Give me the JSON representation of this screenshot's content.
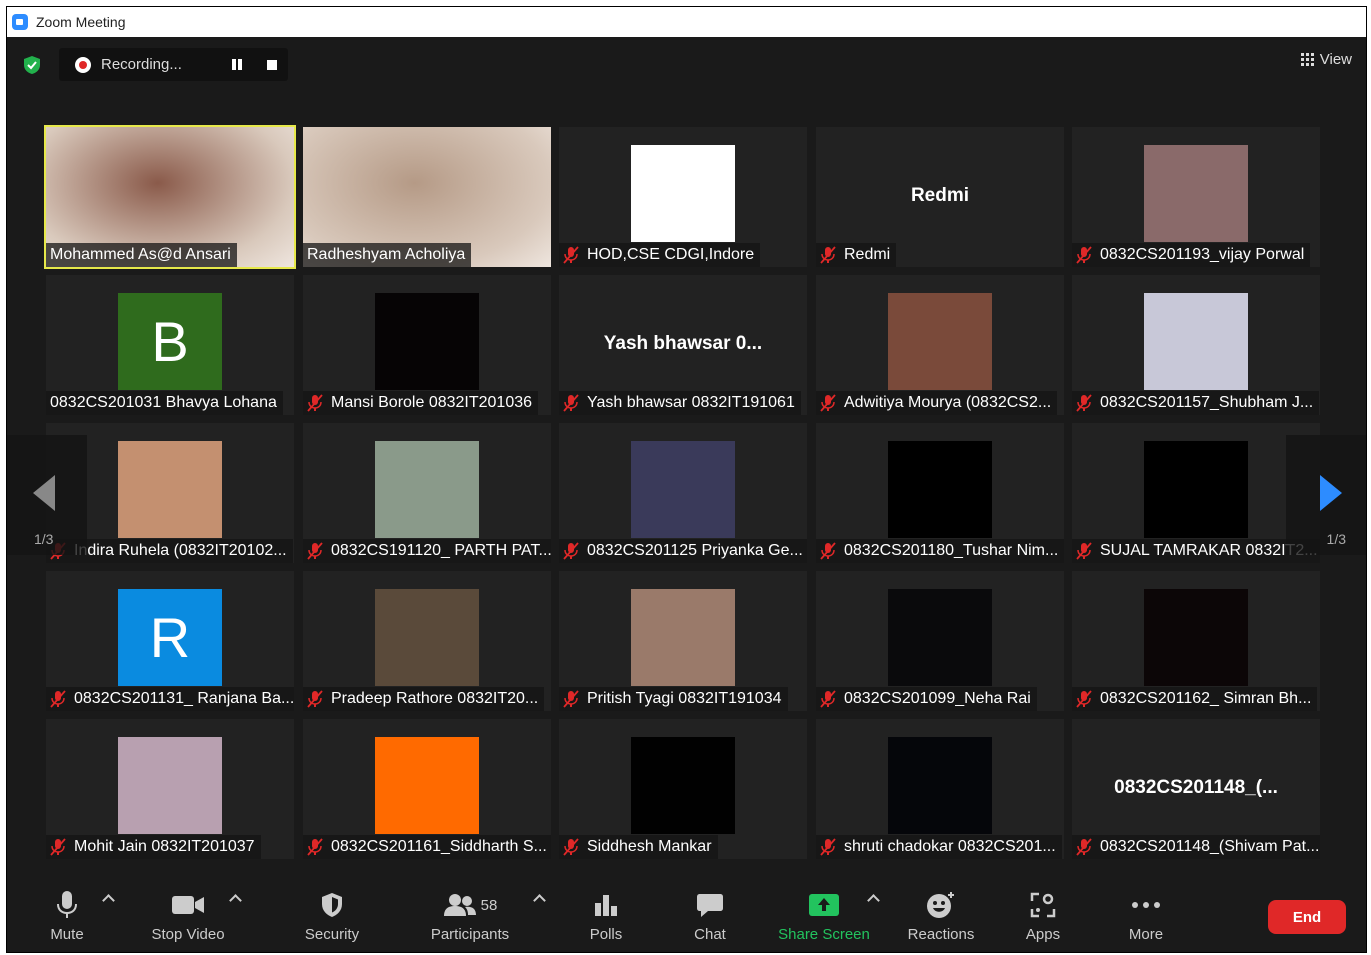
{
  "window": {
    "title": "Zoom Meeting"
  },
  "recording": {
    "label": "Recording..."
  },
  "view": {
    "label": "View"
  },
  "tiles": [
    {
      "name": "Mohammed As@d Ansari",
      "muted": false,
      "type": "video",
      "bg": "#8a5a4a",
      "active": true
    },
    {
      "name": "Radheshyam Acholiya",
      "muted": false,
      "type": "video",
      "bg": "#b59a86"
    },
    {
      "name": "HOD,CSE CDGI,Indore",
      "muted": true,
      "type": "thumb",
      "bg": "#ffffff"
    },
    {
      "name": "Redmi",
      "muted": true,
      "type": "text",
      "display": "Redmi"
    },
    {
      "name": "0832CS201193_vijay Porwal",
      "muted": true,
      "type": "thumb",
      "bg": "#8a6a6a"
    },
    {
      "name": "0832CS201031 Bhavya Lohana",
      "muted": false,
      "type": "avatar",
      "bg": "#2f6b1d",
      "letter": "B"
    },
    {
      "name": "Mansi Borole 0832IT201036",
      "muted": true,
      "type": "thumb",
      "bg": "#060405"
    },
    {
      "name": "Yash bhawsar 0832IT191061",
      "muted": true,
      "type": "text",
      "display": "Yash bhawsar 0..."
    },
    {
      "name": "Adwitiya Mourya (0832CS2...",
      "muted": true,
      "type": "thumb",
      "bg": "#7a4a3a"
    },
    {
      "name": "0832CS201157_Shubham J...",
      "muted": true,
      "type": "thumb",
      "bg": "#c8c8d8"
    },
    {
      "name": "Indira Ruhela (0832IT20102...",
      "muted": true,
      "type": "thumb",
      "bg": "#c49070"
    },
    {
      "name": "0832CS191120_ PARTH PAT...",
      "muted": true,
      "type": "thumb",
      "bg": "#8a9a8a"
    },
    {
      "name": "0832CS201125 Priyanka Ge...",
      "muted": true,
      "type": "thumb",
      "bg": "#3a3a5a"
    },
    {
      "name": "0832CS201180_Tushar Nim...",
      "muted": true,
      "type": "thumb",
      "bg": "#000000"
    },
    {
      "name": "SUJAL TAMRAKAR 0832IT2...",
      "muted": true,
      "type": "thumb",
      "bg": "#000000"
    },
    {
      "name": "0832CS201131_ Ranjana Ba...",
      "muted": true,
      "type": "avatar",
      "bg": "#0a8be0",
      "letter": "R"
    },
    {
      "name": "Pradeep Rathore 0832IT20...",
      "muted": true,
      "type": "thumb",
      "bg": "#5a4a3a"
    },
    {
      "name": "Pritish Tyagi 0832IT191034",
      "muted": true,
      "type": "thumb",
      "bg": "#9a7a6a"
    },
    {
      "name": "0832CS201099_Neha Rai",
      "muted": true,
      "type": "thumb",
      "bg": "#0a0a0c"
    },
    {
      "name": "0832CS201162_ Simran Bh...",
      "muted": true,
      "type": "thumb",
      "bg": "#0c0607"
    },
    {
      "name": "Mohit Jain 0832IT201037",
      "muted": true,
      "type": "thumb",
      "bg": "#b8a0b0"
    },
    {
      "name": "0832CS201161_Siddharth S...",
      "muted": true,
      "type": "thumb",
      "bg": "#ff6a00"
    },
    {
      "name": "Siddhesh Mankar",
      "muted": true,
      "type": "thumb",
      "bg": "#010101"
    },
    {
      "name": "shruti chadokar 0832CS201...",
      "muted": true,
      "type": "thumb",
      "bg": "#05060a"
    },
    {
      "name": "0832CS201148_(Shivam Pat...",
      "muted": true,
      "type": "text",
      "display": "0832CS201148_(..."
    }
  ],
  "pagination": {
    "left": "1/3",
    "right": "1/3"
  },
  "toolbar": {
    "mute": "Mute",
    "stop_video": "Stop Video",
    "security": "Security",
    "participants": "Participants",
    "participants_count": "58",
    "polls": "Polls",
    "chat": "Chat",
    "share_screen": "Share Screen",
    "reactions": "Reactions",
    "apps": "Apps",
    "more": "More",
    "end": "End"
  },
  "colors": {
    "accent": "#2d8cff",
    "share": "#22c35e",
    "end": "#e02828",
    "active_border": "#e6e84a"
  }
}
